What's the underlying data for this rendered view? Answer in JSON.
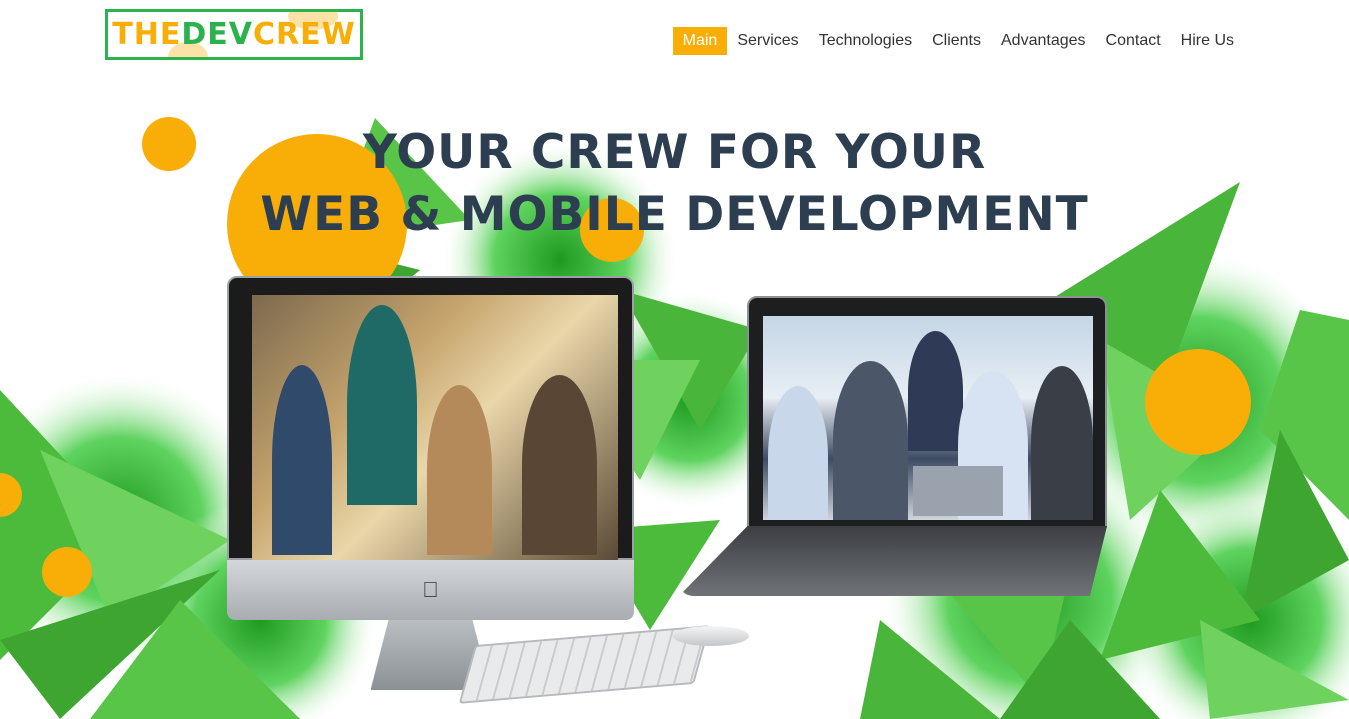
{
  "logo": {
    "part1": "THE",
    "part2": "DEV",
    "part3": "CREW"
  },
  "nav": {
    "items": [
      "Main",
      "Services",
      "Technologies",
      "Clients",
      "Advantages",
      "Contact",
      "Hire Us"
    ],
    "active": "Main"
  },
  "hero": {
    "headline_line1": "YOUR CREW FOR YOUR",
    "headline_line2": "WEB & MOBILE DEVELOPMENT",
    "apple_logo_glyph": ""
  },
  "colors": {
    "accent": "#f9ad07",
    "green": "#2bb24c",
    "heading": "#2c3e50"
  }
}
